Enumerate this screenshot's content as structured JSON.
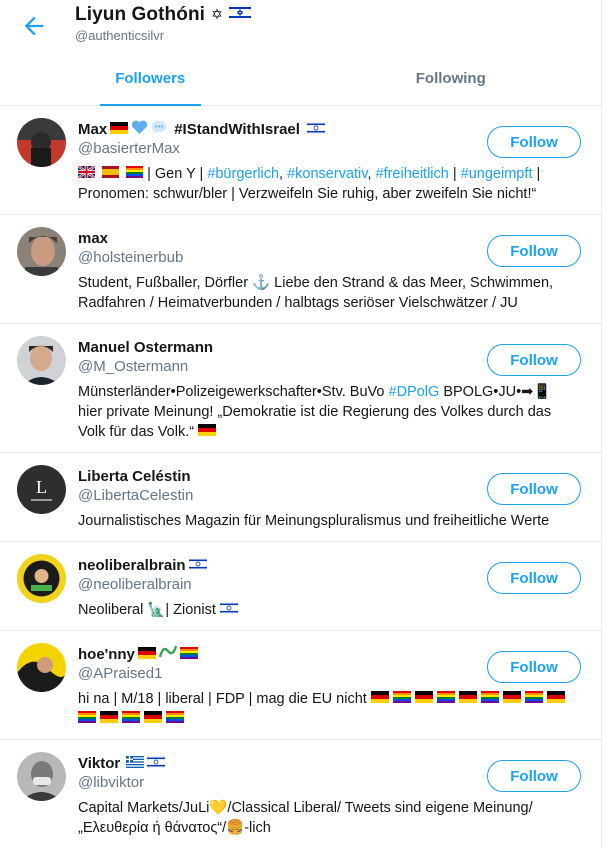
{
  "header": {
    "title": "Liyun Gothóni",
    "title_symbol": "✡",
    "handle": "@authenticsilvr"
  },
  "tabs": [
    "Followers",
    "Following"
  ],
  "follow_label": "Follow",
  "colors": {
    "accent": "#1da1f2",
    "muted": "#657786",
    "text": "#14171a",
    "border": "#e6ecf0"
  },
  "users": [
    {
      "name": "Max",
      "name_suffix": "#IStandWithIsrael",
      "handle": "@basierterMax",
      "bio_parts": [
        {
          "t": " | Gen Y | "
        },
        {
          "t": "#bürgerlich",
          "hl": true
        },
        {
          "t": ", "
        },
        {
          "t": "#konservativ",
          "hl": true
        },
        {
          "t": ", "
        },
        {
          "t": "#freiheitlich",
          "hl": true
        },
        {
          "t": " | "
        },
        {
          "t": "#ungeimpft",
          "hl": true
        },
        {
          "t": " | Pronomen: schwur/bler | Verzweifeln Sie ruhig, aber zweifeln Sie nicht!“"
        }
      ]
    },
    {
      "name": "max",
      "handle": "@holsteinerbub",
      "bio_parts": [
        {
          "t": "Student, Fußballer, Dörfler ⚓ Liebe den Strand & das Meer, Schwimmen, Radfahren / Heimatverbunden / halbtags seriöser Vielschwätzer / JU"
        }
      ]
    },
    {
      "name": "Manuel Ostermann",
      "handle": "@M_Ostermann",
      "bio_parts": [
        {
          "t": "Münsterländer•Polizeigewerkschafter•Stv. BuVo "
        },
        {
          "t": "#DPolG",
          "hl": true
        },
        {
          "t": " BPOLG•JU•➡📱hier private Meinung! „Demokratie ist die Regierung des Volkes durch das Volk für das Volk.“"
        }
      ]
    },
    {
      "name": "Liberta Celéstin",
      "handle": "@LibertaCelestin",
      "bio_parts": [
        {
          "t": "Journalistisches Magazin für Meinungspluralismus und freiheitliche Werte"
        }
      ]
    },
    {
      "name": "neoliberalbrain",
      "handle": "@neoliberalbrain",
      "bio_parts": [
        {
          "t": "Neoliberal 🗽| Zionist "
        }
      ]
    },
    {
      "name": "hoe'nny",
      "handle": "@APraised1",
      "bio_parts": [
        {
          "t": "hi na | M/18 | liberal | FDP | mag die EU nicht "
        }
      ]
    },
    {
      "name": "Viktor",
      "handle": "@libviktor",
      "bio_parts": [
        {
          "t": "Capital Markets/JuLi💛/Classical Liberal/ Tweets sind eigene Meinung/ „Ελευθερία ή θάνατος“/🍔-lich"
        }
      ]
    }
  ]
}
